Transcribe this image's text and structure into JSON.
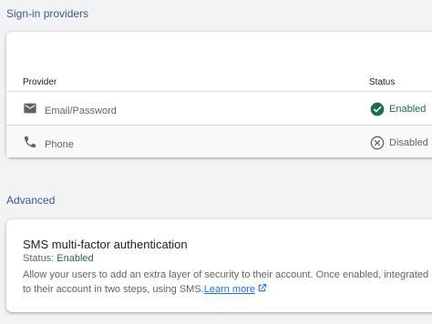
{
  "sign_in_providers": {
    "section_title": "Sign-in providers",
    "columns": {
      "provider": "Provider",
      "status": "Status"
    },
    "rows": [
      {
        "icon": "mail-icon",
        "name": "Email/Password",
        "status": "Enabled",
        "status_icon": "check-circle-icon"
      },
      {
        "icon": "phone-icon",
        "name": "Phone",
        "status": "Disabled",
        "status_icon": "x-circle-icon"
      }
    ]
  },
  "advanced": {
    "section_title": "Advanced",
    "mfa": {
      "title": "SMS multi-factor authentication",
      "status_label": "Status: ",
      "status_value": "Enabled",
      "description_line1": "Allow your users to add an extra layer of security to their account. Once enabled, integrated and",
      "description_line2": "to their account in two steps, using SMS.",
      "learn_more": "Learn more"
    }
  },
  "colors": {
    "enabled": "#1e6b4f",
    "link": "#1a73e8",
    "section_title": "#3c5a8a"
  }
}
